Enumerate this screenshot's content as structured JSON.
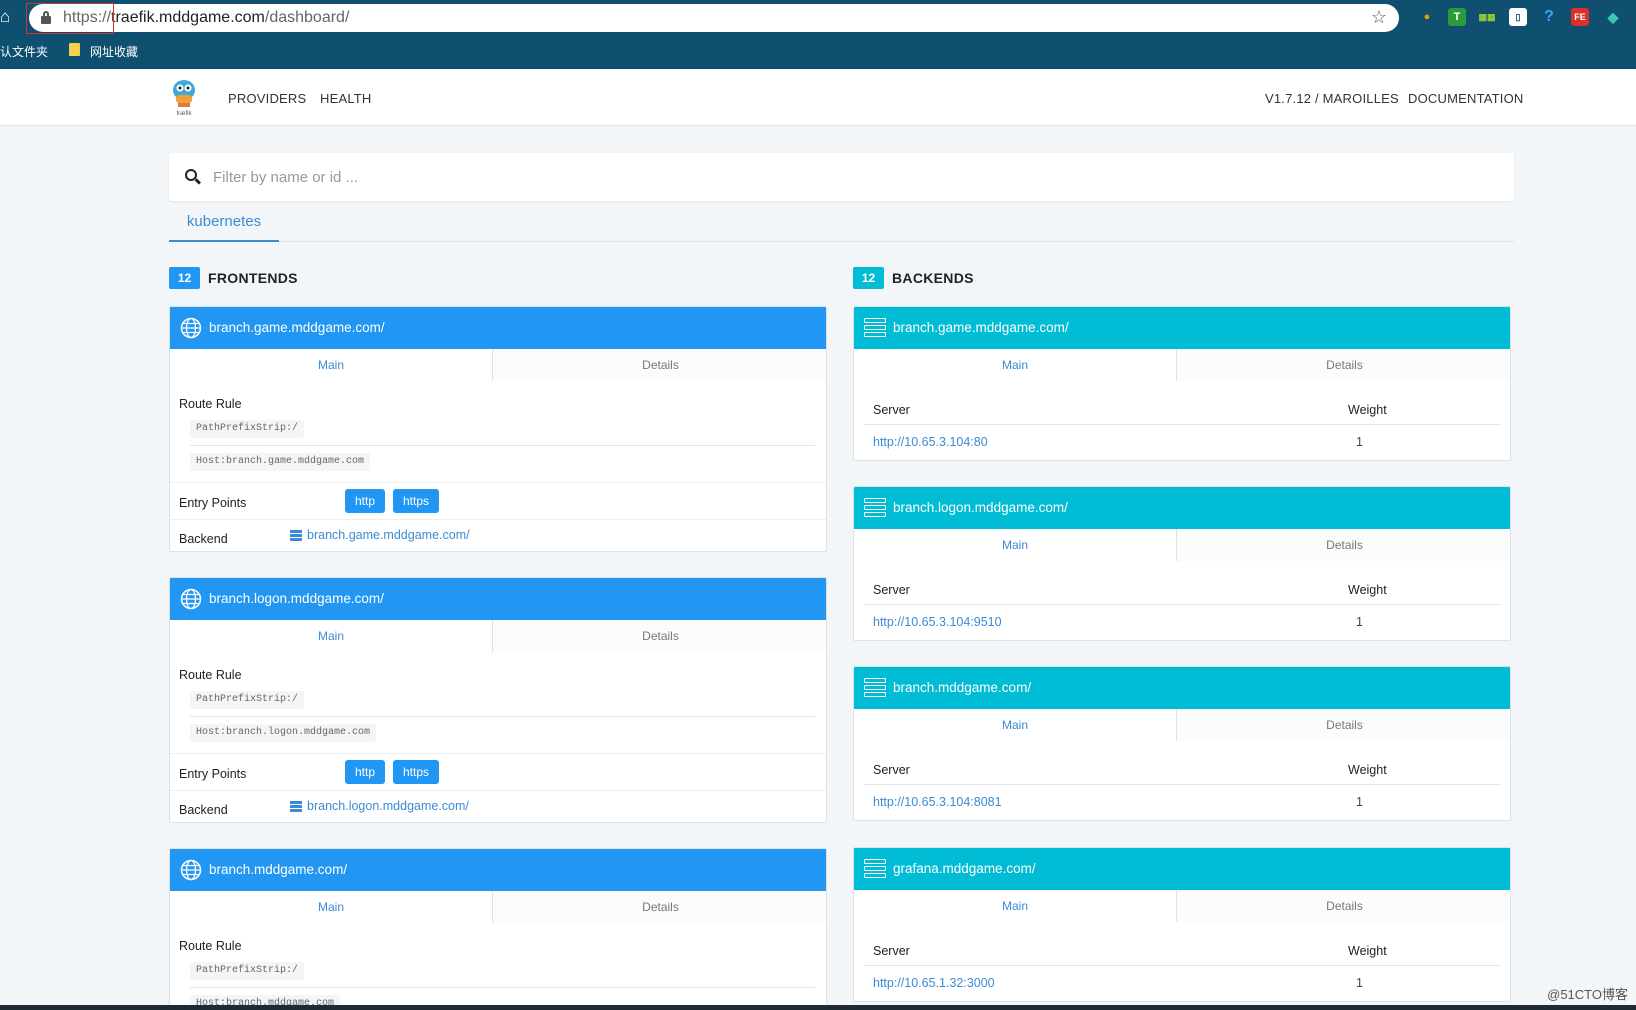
{
  "browser": {
    "url_scheme": "https://",
    "url_host": "traefik.mddgame.com",
    "url_path": "/dashboard/",
    "bookmarks": [
      "认文件夹",
      "网址收藏"
    ]
  },
  "header": {
    "logo_text": "træfik",
    "nav": [
      "PROVIDERS",
      "HEALTH"
    ],
    "version": "V1.7.12 / MAROILLES",
    "documentation": "DOCUMENTATION"
  },
  "filter": {
    "placeholder": "Filter by name or id ..."
  },
  "provider_tab": "kubernetes",
  "frontends": {
    "count": "12",
    "title": "FRONTENDS",
    "tab_main": "Main",
    "tab_details": "Details",
    "route_rule_label": "Route Rule",
    "entry_points_label": "Entry Points",
    "backend_label": "Backend",
    "items": [
      {
        "name": "branch.game.mddgame.com/",
        "rules": [
          "PathPrefixStrip:/",
          "Host:branch.game.mddgame.com"
        ],
        "entry_points": [
          "http",
          "https"
        ],
        "backend": "branch.game.mddgame.com/"
      },
      {
        "name": "branch.logon.mddgame.com/",
        "rules": [
          "PathPrefixStrip:/",
          "Host:branch.logon.mddgame.com"
        ],
        "entry_points": [
          "http",
          "https"
        ],
        "backend": "branch.logon.mddgame.com/"
      },
      {
        "name": "branch.mddgame.com/",
        "rules": [
          "PathPrefixStrip:/",
          "Host:branch.mddgame.com"
        ],
        "entry_points": [],
        "backend": ""
      }
    ]
  },
  "backends": {
    "count": "12",
    "title": "BACKENDS",
    "tab_main": "Main",
    "tab_details": "Details",
    "col_server": "Server",
    "col_weight": "Weight",
    "items": [
      {
        "name": "branch.game.mddgame.com/",
        "server": "http://10.65.3.104:80",
        "weight": "1"
      },
      {
        "name": "branch.logon.mddgame.com/",
        "server": "http://10.65.3.104:9510",
        "weight": "1"
      },
      {
        "name": "branch.mddgame.com/",
        "server": "http://10.65.3.104:8081",
        "weight": "1"
      },
      {
        "name": "grafana.mddgame.com/",
        "server": "http://10.65.1.32:3000",
        "weight": "1"
      }
    ]
  },
  "watermark": "@51CTO博客",
  "colors": {
    "frontend_header": "#2196f3",
    "backend_header": "#00bcd4",
    "chrome": "#0f4f70",
    "link": "#3b8bd4"
  }
}
